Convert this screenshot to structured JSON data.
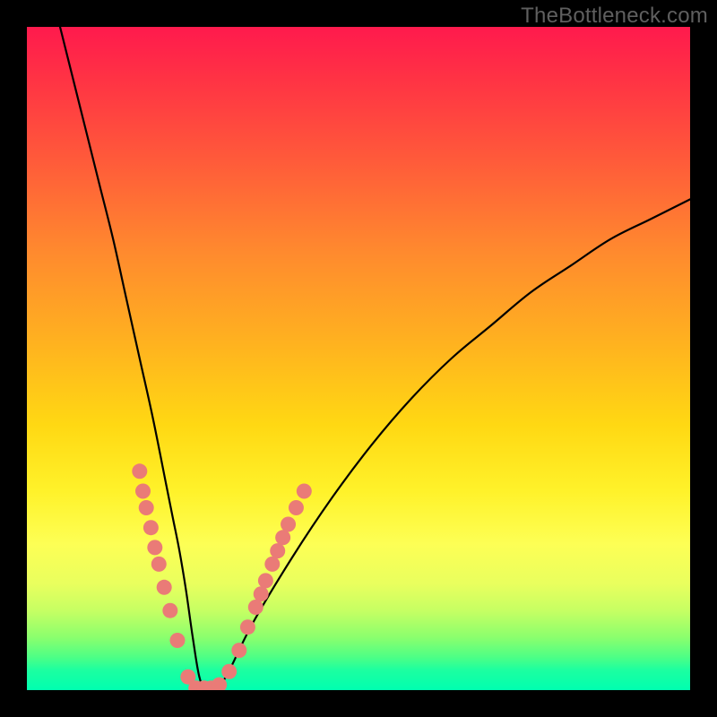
{
  "watermark": "TheBottleneck.com",
  "chart_data": {
    "type": "line",
    "title": "",
    "xlabel": "",
    "ylabel": "",
    "xlim": [
      0,
      100
    ],
    "ylim": [
      0,
      100
    ],
    "grid": false,
    "legend": false,
    "series": [
      {
        "name": "bottleneck-curve",
        "x": [
          5,
          7,
          9,
          11,
          13,
          15,
          17,
          19,
          21,
          22,
          23,
          24,
          25,
          26,
          27,
          28,
          30,
          34,
          40,
          46,
          52,
          58,
          64,
          70,
          76,
          82,
          88,
          94,
          100
        ],
        "y": [
          100,
          92,
          84,
          76,
          68,
          59,
          50,
          41,
          31,
          26,
          21,
          15,
          8,
          2,
          0,
          0,
          2,
          10,
          20,
          29,
          37,
          44,
          50,
          55,
          60,
          64,
          68,
          71,
          74
        ]
      }
    ],
    "markers": {
      "name": "highlight-dots",
      "color": "#ea7b77",
      "points": [
        {
          "x": 17.0,
          "y": 33.0
        },
        {
          "x": 17.5,
          "y": 30.0
        },
        {
          "x": 18.0,
          "y": 27.5
        },
        {
          "x": 18.7,
          "y": 24.5
        },
        {
          "x": 19.3,
          "y": 21.5
        },
        {
          "x": 19.9,
          "y": 19.0
        },
        {
          "x": 20.7,
          "y": 15.5
        },
        {
          "x": 21.6,
          "y": 12.0
        },
        {
          "x": 22.7,
          "y": 7.5
        },
        {
          "x": 24.3,
          "y": 2.0
        },
        {
          "x": 25.5,
          "y": 0.3
        },
        {
          "x": 26.7,
          "y": 0.3
        },
        {
          "x": 27.8,
          "y": 0.3
        },
        {
          "x": 29.0,
          "y": 0.8
        },
        {
          "x": 30.5,
          "y": 2.8
        },
        {
          "x": 32.0,
          "y": 6.0
        },
        {
          "x": 33.3,
          "y": 9.5
        },
        {
          "x": 34.5,
          "y": 12.5
        },
        {
          "x": 35.3,
          "y": 14.5
        },
        {
          "x": 36.0,
          "y": 16.5
        },
        {
          "x": 37.0,
          "y": 19.0
        },
        {
          "x": 37.8,
          "y": 21.0
        },
        {
          "x": 38.6,
          "y": 23.0
        },
        {
          "x": 39.4,
          "y": 25.0
        },
        {
          "x": 40.6,
          "y": 27.5
        },
        {
          "x": 41.8,
          "y": 30.0
        }
      ]
    },
    "background_gradient": {
      "top": "#ff1a4d",
      "middle": "#fff22a",
      "bottom": "#00ffb0"
    }
  }
}
